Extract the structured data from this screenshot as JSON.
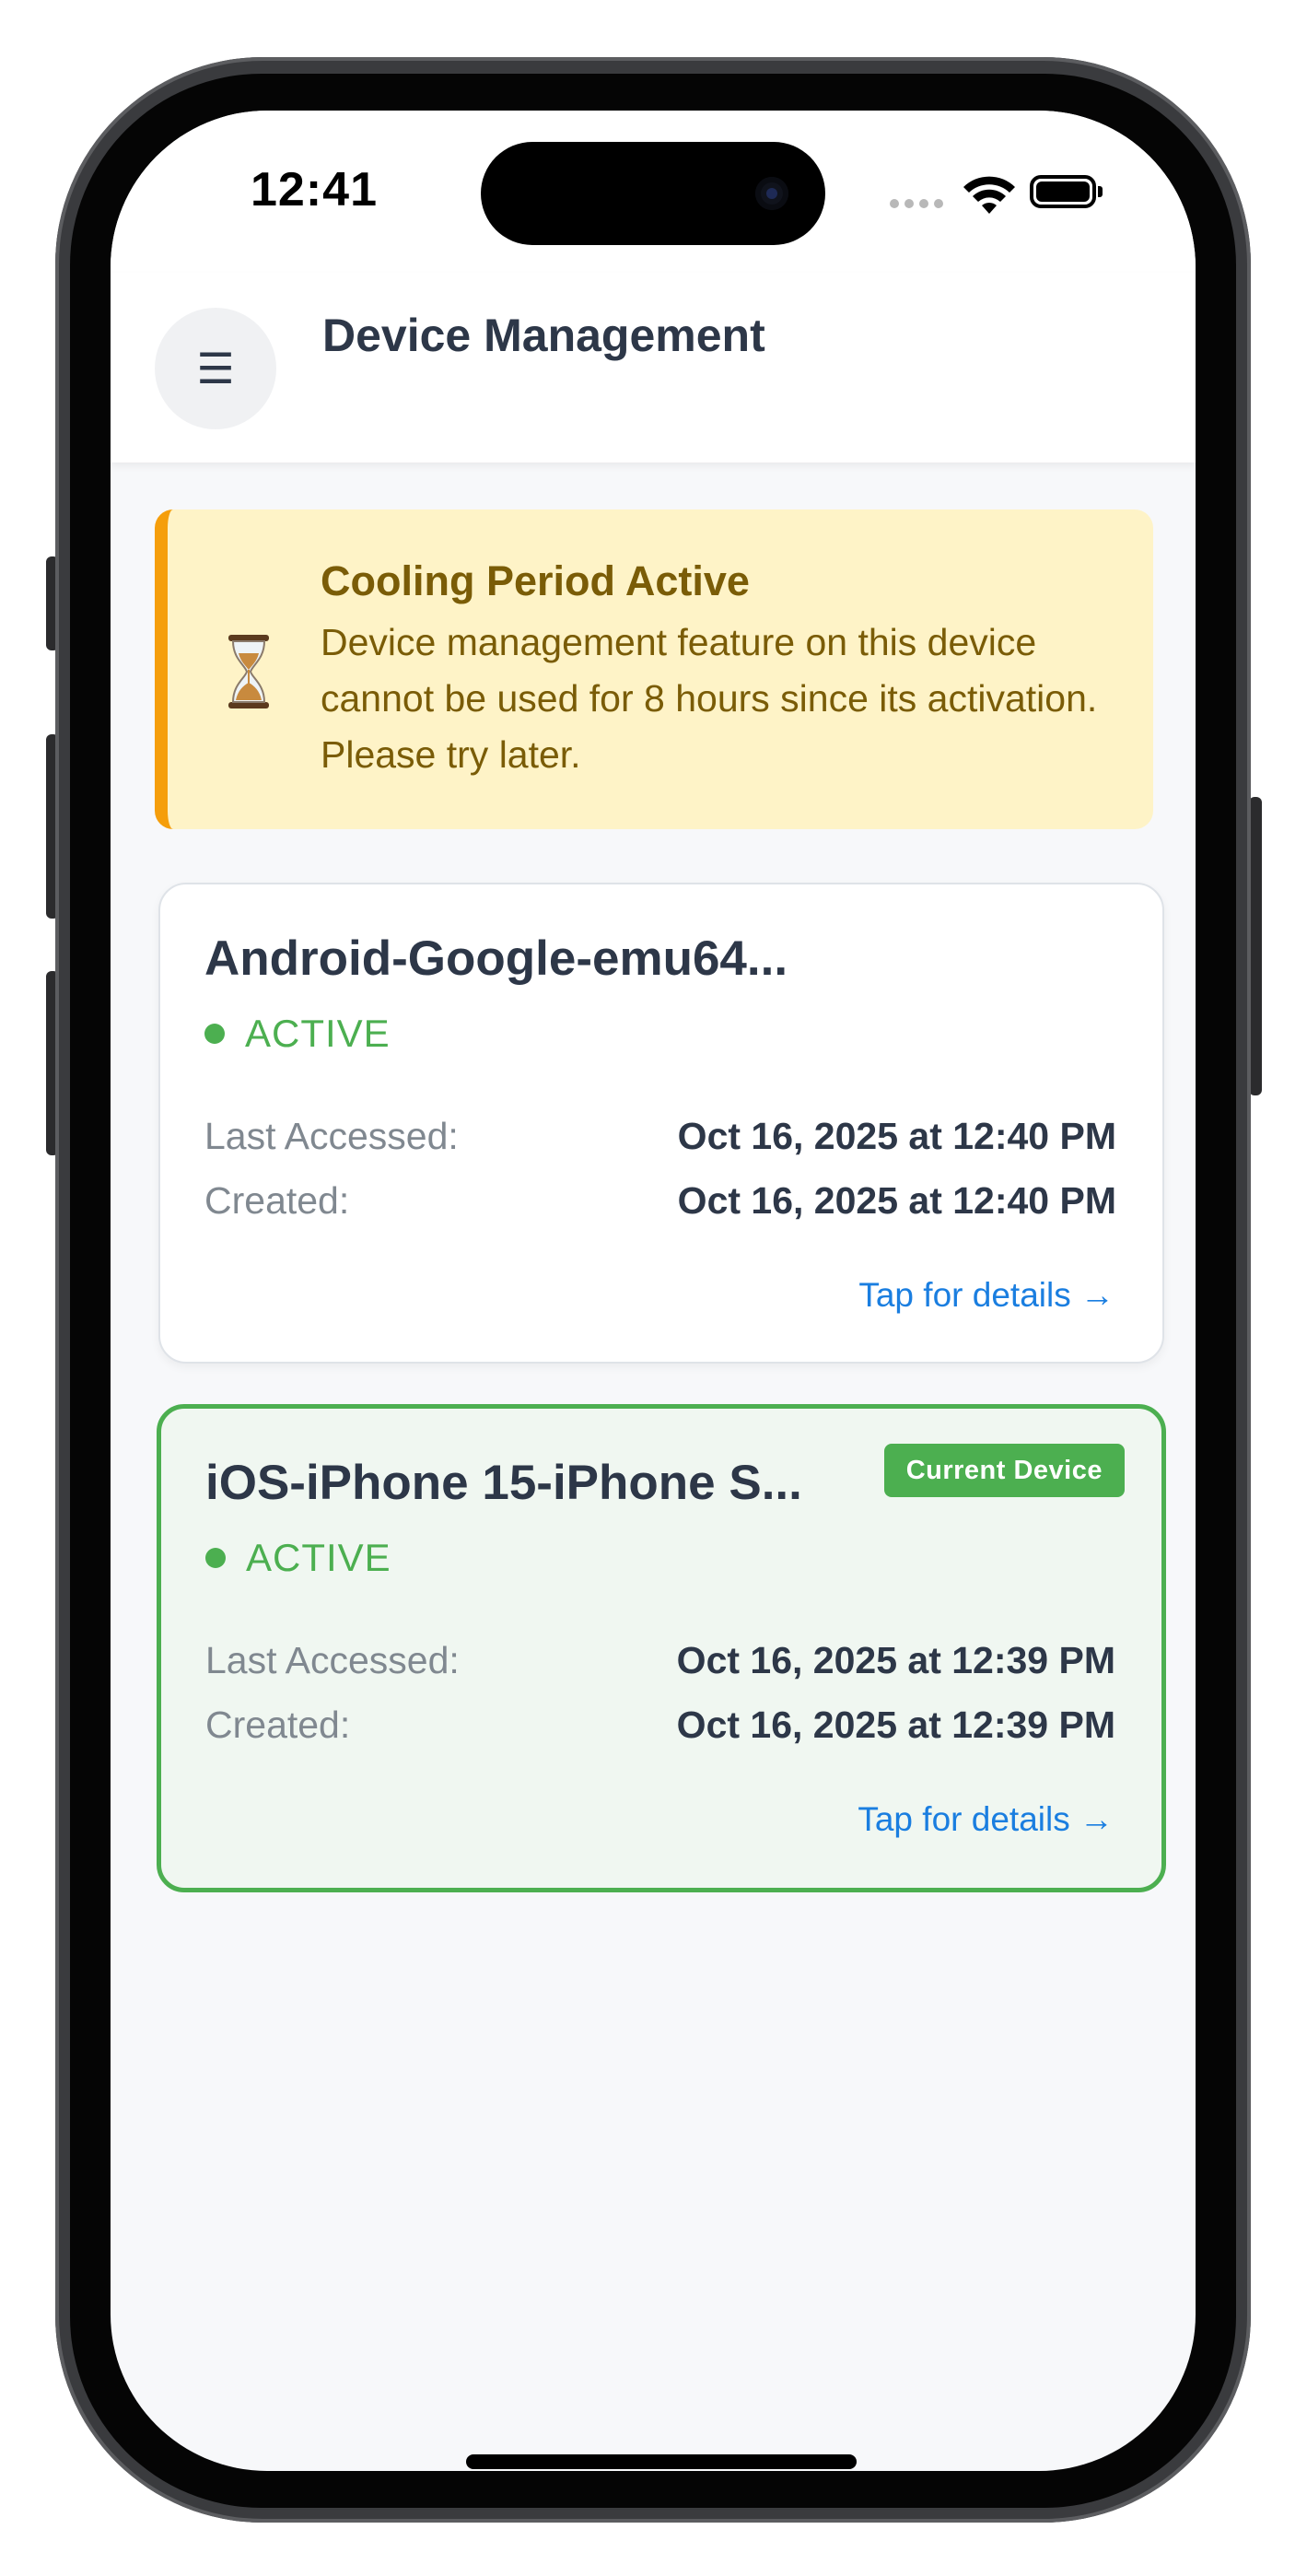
{
  "status_bar": {
    "time": "12:41"
  },
  "header": {
    "menu_icon": "☰",
    "title": "Device Management"
  },
  "alert": {
    "icon": "hourglass-icon",
    "title": "Cooling Period Active",
    "message": "Device management feature on this device cannot be used for 8 hours since its activation. Please try later.",
    "accent_color": "#f59e0b",
    "background_color": "#fef3c7"
  },
  "devices": [
    {
      "name": "Android-Google-emu64...",
      "status": "ACTIVE",
      "last_accessed_label": "Last Accessed:",
      "last_accessed": "Oct 16, 2025 at 12:40 PM",
      "created_label": "Created:",
      "created": "Oct 16, 2025 at 12:40 PM",
      "link": "Tap for details →"
    },
    {
      "name": "iOS-iPhone 15-iPhone S...",
      "badge": "Current Device",
      "status": "ACTIVE",
      "last_accessed_label": "Last Accessed:",
      "last_accessed": "Oct 16, 2025 at 12:39 PM",
      "created_label": "Created:",
      "created": "Oct 16, 2025 at 12:39 PM",
      "link": "Tap for details →"
    }
  ],
  "colors": {
    "active_green": "#4caf50",
    "link_blue": "#1a7ee0",
    "text_dark": "#2d3748"
  }
}
